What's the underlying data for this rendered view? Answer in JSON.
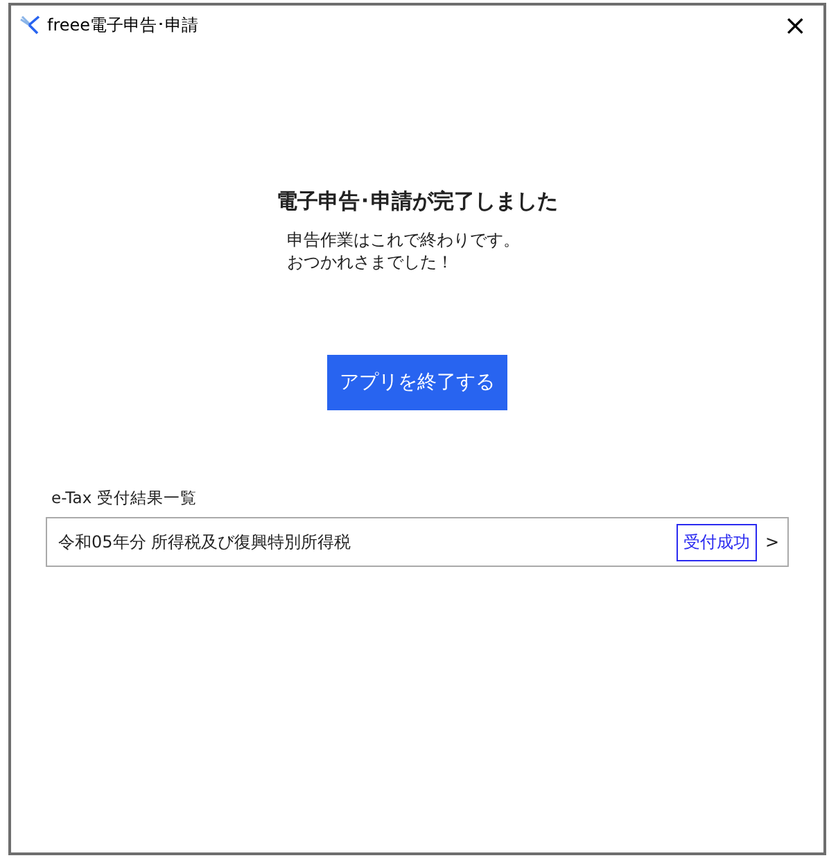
{
  "window": {
    "title": "freee電子申告･申請",
    "close": "×"
  },
  "heading": "電子申告･申請が完了しました",
  "message": [
    "申告作業はこれで終わりです。",
    "おつかれさまでした！"
  ],
  "primary_button": "アプリを終了する",
  "results": {
    "title": "e-Tax 受付結果一覧",
    "rows": [
      {
        "name": "令和05年分 所得税及び復興特別所得税",
        "status": "受付成功",
        "chevron": ">"
      }
    ]
  }
}
